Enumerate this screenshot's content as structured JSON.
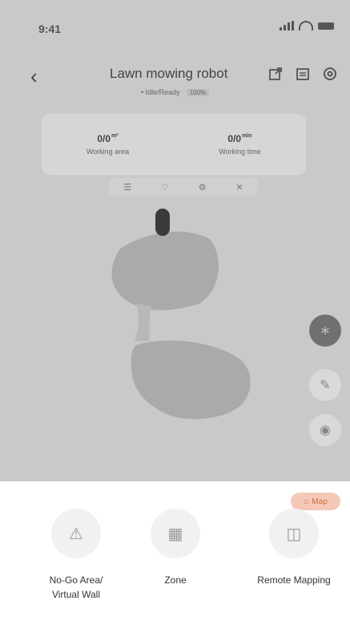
{
  "status_bar": {
    "time": "9:41"
  },
  "header": {
    "title": "Lawn mowing robot",
    "subtitle": "• Idle/Ready",
    "tag": "100%",
    "icons": [
      "share-icon",
      "calendar-icon",
      "settings-icon"
    ]
  },
  "stats": [
    {
      "value": "0/0",
      "unit": "m²",
      "label": "Working area"
    },
    {
      "value": "0/0",
      "unit": "min",
      "label": "Working time"
    }
  ],
  "toolbar_icons": [
    "wifi-icon",
    "cloud-icon",
    "gear-icon",
    "close-icon"
  ],
  "map_chip": {
    "label": "Map"
  },
  "options": [
    {
      "label": "No-Go Area/\nVirtual Wall",
      "icon": "warning-icon"
    },
    {
      "label": "Zone",
      "icon": "zone-icon"
    },
    {
      "label": "Remote Mapping",
      "icon": "remote-mapping-icon"
    }
  ]
}
